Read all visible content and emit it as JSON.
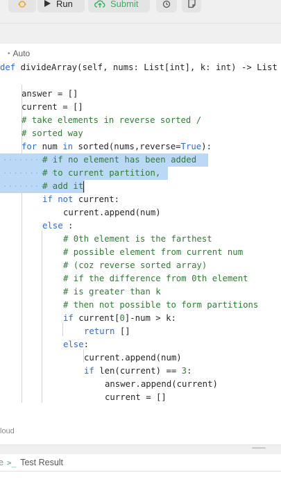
{
  "toolbar": {
    "debug_icon": "bug-icon",
    "run_label": "Run",
    "run_icon": "play-icon",
    "submit_label": "Submit",
    "submit_icon": "cloud-upload-icon",
    "timer_icon": "alarm-clock-icon",
    "notes_icon": "note-icon",
    "submit_color": "#2db55d"
  },
  "editor": {
    "mode_label": "Auto",
    "code_lines": [
      "def divideArray(self, nums: List[int], k: int) -> List",
      "",
      "    answer = []",
      "    current = []",
      "    # take elements in reverse sorted /",
      "    # sorted way",
      "    for num in sorted(nums,reverse=True):",
      "        # if no element has been added",
      "        # to current partition,",
      "        # add it",
      "        if not current:",
      "            current.append(num)",
      "        else :",
      "            # 0th element is the farthest",
      "            # possible element from current num",
      "            # (coz reverse sorted array)",
      "            # if the difference from 0th element",
      "            # is greater than k",
      "            # then not possible to form partitions",
      "            if current[0]-num > k:",
      "                return []",
      "            else:",
      "                current.append(num)",
      "                if len(current) == 3:",
      "                    answer.append(current)",
      "                    current = []"
    ],
    "highlight_color": "#bcd8f7",
    "keyword_color": "#2f6ad8",
    "comment_color": "#2e7d32"
  },
  "footer": {
    "cloud_label": "loud",
    "test_result_label": "Test Result",
    "terminal_icon": "terminal-icon"
  }
}
